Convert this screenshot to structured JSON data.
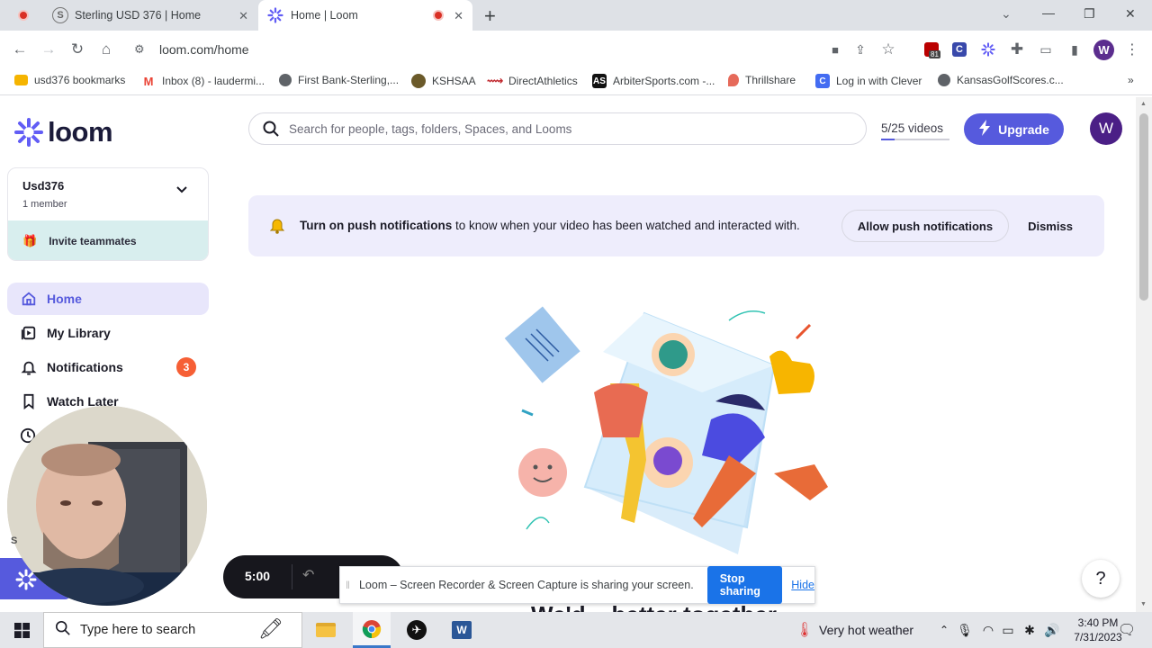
{
  "browser": {
    "tabs": [
      {
        "title": "Sterling USD 376 | Home",
        "favicon": "sterling-logo"
      },
      {
        "title": "Home | Loom",
        "favicon": "loom-logo"
      }
    ],
    "new_tab": "+",
    "window_controls": {
      "minimize": "—",
      "restore": "❐",
      "close": "✕"
    },
    "url": "loom.com/home",
    "extension_badge": "81",
    "profile_initial": "W",
    "bookmarks": [
      {
        "label": "usd376 bookmarks",
        "icon": "folder-icon",
        "color": "#f5b400"
      },
      {
        "label": "Inbox (8) - laudermi...",
        "icon": "gmail-icon",
        "color": "#ea4335"
      },
      {
        "label": "First Bank-Sterling,...",
        "icon": "globe-icon",
        "color": "#5f6368"
      },
      {
        "label": "KSHSAA",
        "icon": "kshsaa-icon",
        "color": "#6b5a2a"
      },
      {
        "label": "DirectAthletics",
        "icon": "directathletics-icon",
        "color": "#c0272d"
      },
      {
        "label": "ArbiterSports.com -...",
        "icon": "arbiter-icon",
        "color": "#111111"
      },
      {
        "label": "Thrillshare",
        "icon": "thrillshare-icon",
        "color": "#e66a5a"
      },
      {
        "label": "Log in with Clever",
        "icon": "clever-icon",
        "color": "#436cf2"
      },
      {
        "label": "KansasGolfScores.c...",
        "icon": "globe-icon",
        "color": "#5f6368"
      }
    ]
  },
  "loom": {
    "logo_text": "loom",
    "workspace": {
      "name": "Usd376",
      "members": "1 member",
      "invite": "Invite teammates"
    },
    "nav": [
      {
        "label": "Home",
        "icon": "home-icon",
        "active": true
      },
      {
        "label": "My Library",
        "icon": "library-icon"
      },
      {
        "label": "Notifications",
        "icon": "bell-icon",
        "badge": "3"
      },
      {
        "label": "Watch Later",
        "icon": "bookmark-icon"
      }
    ],
    "search_placeholder": "Search for people, tags, folders, Spaces, and Looms",
    "video_count": "5/25 videos",
    "video_fraction": 0.2,
    "upgrade": "Upgrade",
    "avatar_initial": "W",
    "banner": {
      "bold": "Turn on push notifications",
      "text": " to know when your video has been watched and interacted with.",
      "allow": "Allow push notifications",
      "dismiss": "Dismiss"
    },
    "heading_partial": "We'd... better together",
    "help": "?",
    "recorder": {
      "timer": "5:00"
    },
    "share_bar": {
      "message": "Loom – Screen Recorder & Screen Capture is sharing your screen.",
      "stop": "Stop sharing",
      "hide": "Hide"
    }
  },
  "taskbar": {
    "search_placeholder": "Type here to search",
    "weather": "Very hot weather",
    "time": "3:40 PM",
    "date": "7/31/2023"
  },
  "colors": {
    "loom_purple": "#565add",
    "loom_blue_logo": "#625df5",
    "badge_orange": "#f65f35",
    "chrome_blue": "#1a73e8"
  }
}
